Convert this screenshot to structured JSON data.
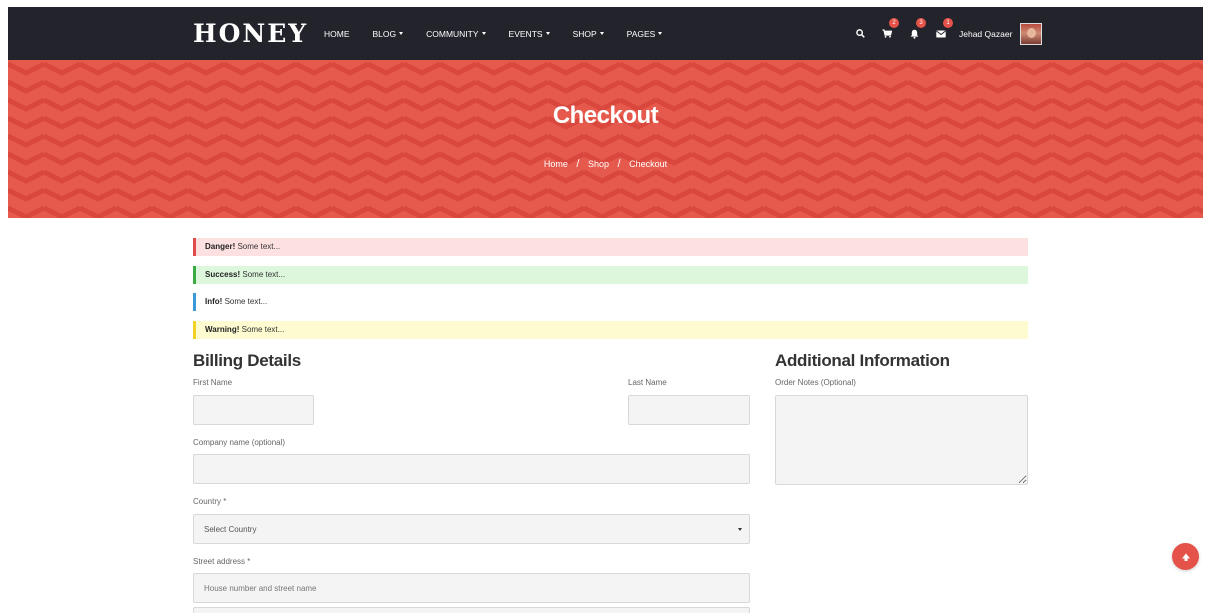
{
  "navbar": {
    "logo": "HONEY",
    "menu": [
      {
        "label": "HOME",
        "has_caret": false
      },
      {
        "label": "BLOG",
        "has_caret": true
      },
      {
        "label": "COMMUNITY",
        "has_caret": true
      },
      {
        "label": "EVENTS",
        "has_caret": true
      },
      {
        "label": "SHOP",
        "has_caret": true
      },
      {
        "label": "PAGES",
        "has_caret": true
      }
    ],
    "icons": {
      "search": "search-icon",
      "cart": {
        "icon": "cart-icon",
        "badge": "2"
      },
      "notifications": {
        "icon": "bell-icon",
        "badge": "3"
      },
      "messages": {
        "icon": "envelope-icon",
        "badge": "1"
      }
    },
    "user_name": "Jehad Qazaer",
    "colors": {
      "background": "#23232b",
      "badge": "#e5524a"
    }
  },
  "hero": {
    "title": "Checkout",
    "breadcrumb": {
      "home": "Home",
      "shop": "Shop",
      "current": "Checkout",
      "separator": "/"
    },
    "colors": {
      "base": "#e65a4d",
      "chevron": "#d9473d"
    }
  },
  "alerts": {
    "danger": {
      "strong": "Danger!",
      "text": "Some text..."
    },
    "success": {
      "strong": "Success!",
      "text": "Some text..."
    },
    "info": {
      "strong": "Info!",
      "text": "Some text..."
    },
    "warning": {
      "strong": "Warning!",
      "text": "Some text..."
    }
  },
  "billing": {
    "title": "Billing Details",
    "first_name_label": "First Name",
    "last_name_label": "Last Name",
    "company_label": "Company name (optional)",
    "country_label": "Country *",
    "country_value": "Select Country",
    "street_label": "Street address *",
    "street_placeholder": "House number and street name"
  },
  "additional": {
    "title": "Additional Information",
    "notes_label": "Order Notes (Optional)"
  },
  "scroll_top": {
    "icon": "arrow-up-icon",
    "color": "#e5524a"
  }
}
